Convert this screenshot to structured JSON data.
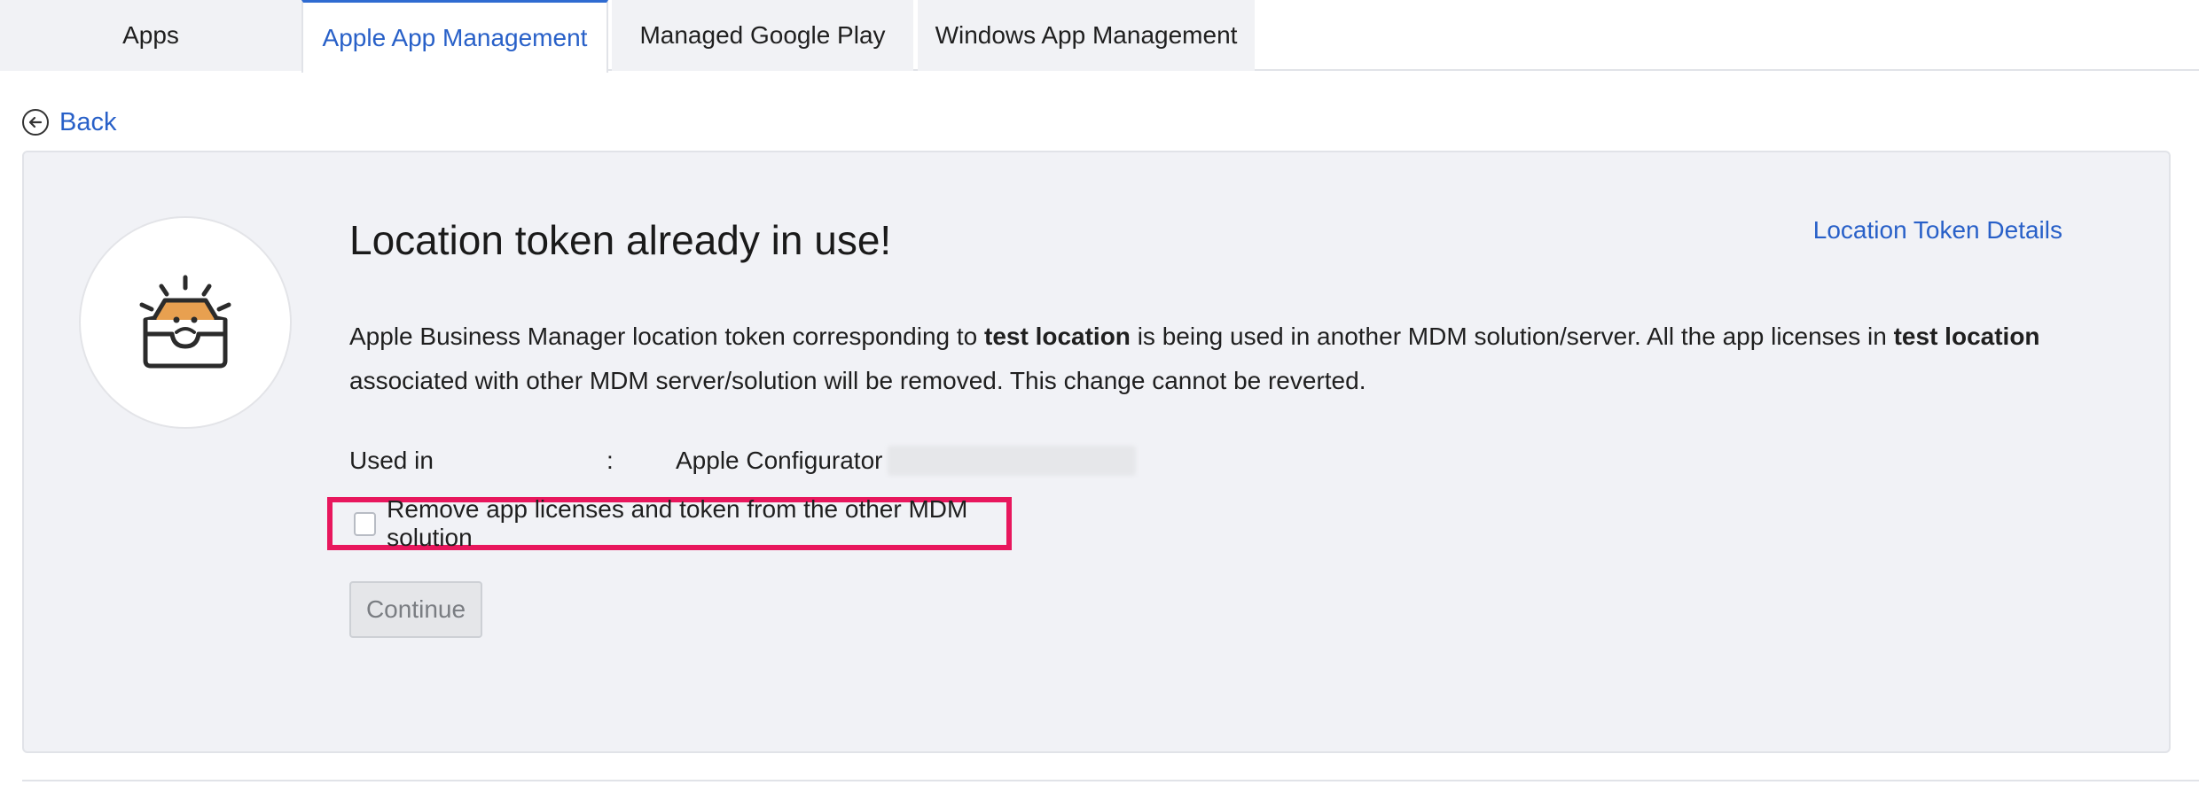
{
  "tabs": [
    {
      "label": "Apps",
      "active": false
    },
    {
      "label": "Apple App Management",
      "active": true
    },
    {
      "label": "Managed Google Play",
      "active": false
    },
    {
      "label": "Windows App Management",
      "active": false
    }
  ],
  "back_label": "Back",
  "card": {
    "title": "Location token already in use!",
    "details_link": "Location Token Details",
    "description": {
      "part1": "Apple Business Manager location token corresponding to ",
      "location1": "test location",
      "part2": " is being used in another MDM solution/server. All the app licenses in ",
      "location2": "test location",
      "part3": " associated with other MDM server/solution will be removed. This change cannot be reverted."
    },
    "used_in": {
      "label": "Used in",
      "separator": ":",
      "value": "Apple Configurator"
    },
    "checkbox": {
      "label": "Remove app licenses and token from the other MDM solution",
      "checked": false
    },
    "continue_label": "Continue"
  },
  "colors": {
    "accent": "#2860c8",
    "highlight": "#e8175d",
    "card_bg": "#f1f2f6",
    "icon_orange": "#e8a050"
  },
  "icons": {
    "back": "back-arrow-circle-icon",
    "illustration": "sad-inbox-icon"
  }
}
